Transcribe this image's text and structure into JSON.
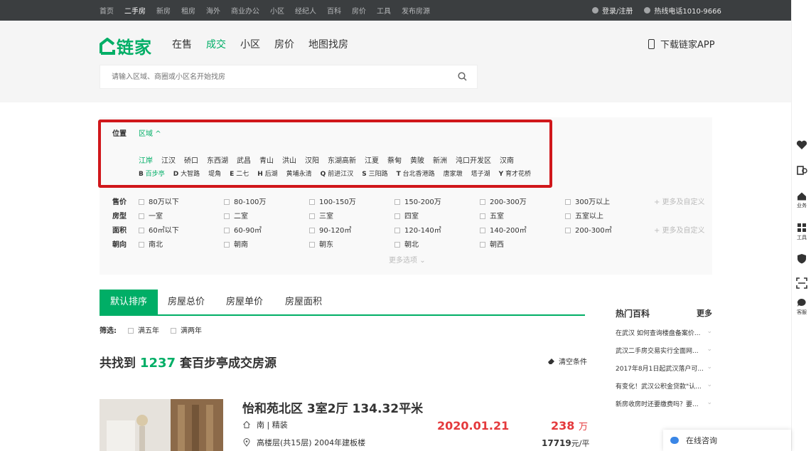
{
  "topbar": {
    "nav": [
      "首页",
      "二手房",
      "新房",
      "租房",
      "海外",
      "商业办公",
      "小区",
      "经纪人",
      "百科",
      "房价",
      "工具",
      "发布房源"
    ],
    "active": "二手房",
    "login": "登录/注册",
    "hotline": "热线电话1010-9666"
  },
  "logo": {
    "text": "链家"
  },
  "mainnav": [
    "在售",
    "成交",
    "小区",
    "房价",
    "地图找房"
  ],
  "mainnav_active": "成交",
  "app_label": "下载链家APP",
  "search": {
    "placeholder": "请输入区域、商圈或小区名开始找房"
  },
  "filter": {
    "position_label": "位置",
    "region_label": "区域",
    "districts": [
      "江岸",
      "江汉",
      "硚口",
      "东西湖",
      "武昌",
      "青山",
      "洪山",
      "汉阳",
      "东湖高新",
      "江夏",
      "蔡甸",
      "黄陂",
      "新洲",
      "沌口开发区",
      "汉南"
    ],
    "areas": [
      {
        "letter": "B",
        "name": "百步亭",
        "active": true
      },
      {
        "letter": "D",
        "name": "大智路"
      },
      {
        "letter": "",
        "name": "堤角"
      },
      {
        "letter": "E",
        "name": "二七"
      },
      {
        "letter": "H",
        "name": "后湖"
      },
      {
        "letter": "",
        "name": "黄埔永清"
      },
      {
        "letter": "Q",
        "name": "前进江汉"
      },
      {
        "letter": "S",
        "name": "三阳路"
      },
      {
        "letter": "T",
        "name": "台北香港路"
      },
      {
        "letter": "",
        "name": "唐家墩"
      },
      {
        "letter": "",
        "name": "塔子湖"
      },
      {
        "letter": "Y",
        "name": "育才花桥"
      }
    ],
    "price": {
      "label": "售价",
      "options": [
        "80万以下",
        "80-100万",
        "100-150万",
        "150-200万",
        "200-300万",
        "300万以上"
      ],
      "more": "+ 更多及自定义"
    },
    "layout": {
      "label": "房型",
      "options": [
        "一室",
        "二室",
        "三室",
        "四室",
        "五室",
        "五室以上"
      ]
    },
    "area": {
      "label": "面积",
      "options": [
        "60㎡以下",
        "60-90㎡",
        "90-120㎡",
        "120-140㎡",
        "140-200㎡",
        "200-300㎡"
      ],
      "more": "+ 更多及自定义"
    },
    "orientation": {
      "label": "朝向",
      "options": [
        "南北",
        "朝南",
        "朝东",
        "朝北",
        "朝西"
      ]
    },
    "more_options": "更多选项"
  },
  "tabs": [
    "默认排序",
    "房屋总价",
    "房屋单价",
    "房屋面积"
  ],
  "screen": {
    "label": "筛选:",
    "options": [
      "满五年",
      "满两年"
    ]
  },
  "result": {
    "prefix": "共找到",
    "count": "1237",
    "suffix": "套百步亭成交房源"
  },
  "clear_label": "清空条件",
  "listing": {
    "title": "怡和苑北区 3室2厅 134.32平米",
    "house_info": "南 | 精装",
    "position_info": "高楼层(共15层) 2004年建板楼",
    "deal_date": "2020.01.21",
    "total_price": "238",
    "total_unit": "万",
    "unit_price": "17719",
    "unit_price_suffix": "元/平"
  },
  "sidebar": {
    "title": "热门百科",
    "more": "更多",
    "items": [
      "在武汉 如何查询楼盘备案价...",
      "武汉二手房交易实行全面网...",
      "2017年8月1日起武汉落户可...",
      "有变化！武汉公积金贷款\"认...",
      "新房收房时还要缴费吗？要..."
    ]
  },
  "rail": {
    "labels": [
      "",
      "",
      "业务",
      "工具",
      "",
      "",
      "客服"
    ]
  },
  "consult": "在线咨询",
  "colors": {
    "accent": "#00ae66",
    "price": "#e4393c",
    "topbar": "#3b3e40",
    "highlight": "#d0171b"
  }
}
